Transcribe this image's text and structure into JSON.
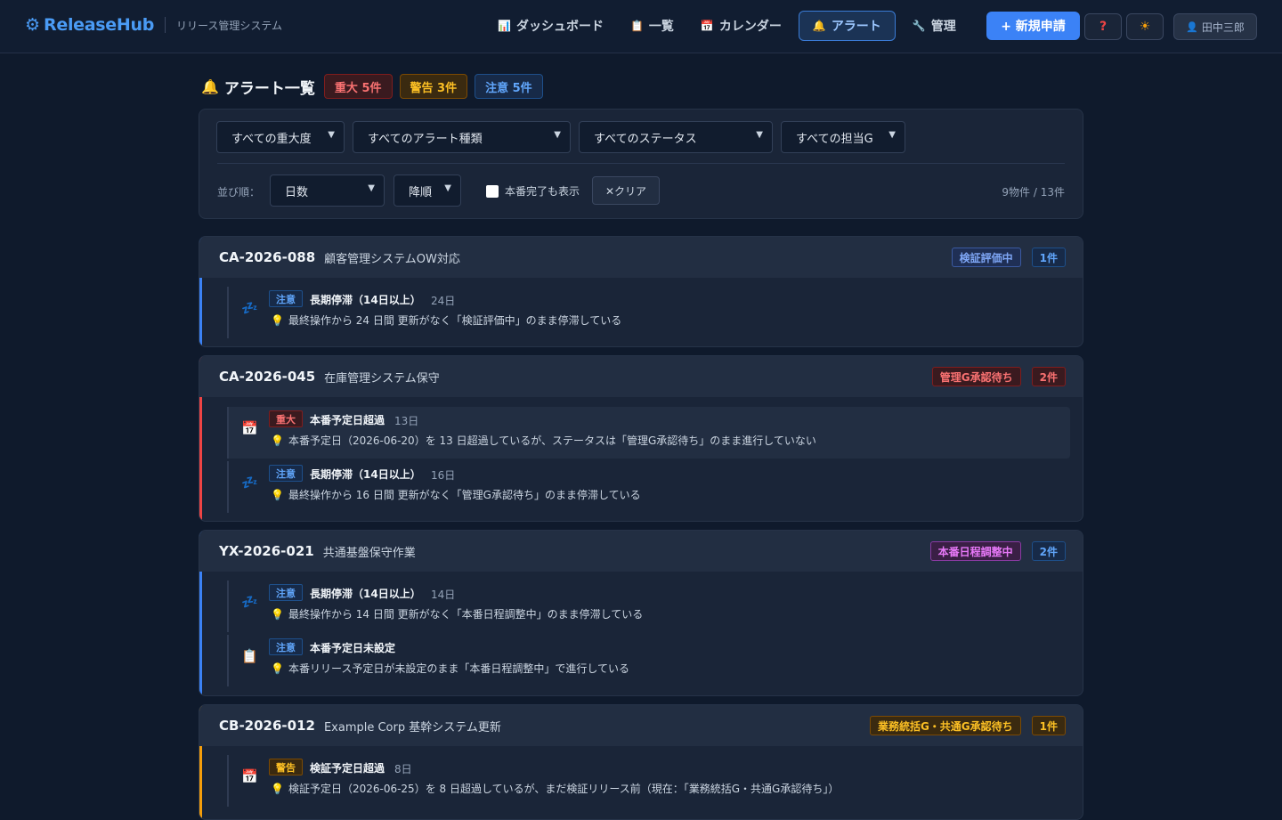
{
  "header": {
    "brand_icon": "gear-icon",
    "brand": "ReleaseHub",
    "subtitle": "リリース管理システム",
    "nav": [
      {
        "icon": "chart-icon",
        "glyph": "📊",
        "label": "ダッシュボード"
      },
      {
        "icon": "list-icon",
        "glyph": "📋",
        "label": "一覧"
      },
      {
        "icon": "calendar-icon",
        "glyph": "📅",
        "label": "カレンダー"
      },
      {
        "icon": "bell-icon",
        "glyph": "🔔",
        "label": "アラート"
      },
      {
        "icon": "wrench-icon",
        "glyph": "🔧",
        "label": "管理"
      }
    ],
    "new_button": "+ 新規申請",
    "help": "?",
    "theme_icon": "sun-icon",
    "user": "田中三郎"
  },
  "page": {
    "title": "アラート一覧",
    "counts": {
      "critical": "重大 5件",
      "warning": "警告 3件",
      "notice": "注意 5件"
    }
  },
  "filters": {
    "severity": "すべての重大度",
    "type": "すべてのアラート種類",
    "status": "すべてのステータス",
    "group": "すべての担当G",
    "sort_label": "並び順：",
    "sort_field": "日数",
    "sort_order": "降順",
    "show_completed": "本番完了も表示",
    "show_completed_checked": false,
    "clear": "✕クリア",
    "result": "9物件 / 13件"
  },
  "cards": [
    {
      "id": "CA-2026-088",
      "name": "顧客管理システムOW対応",
      "status": "検証評価中",
      "count": "1件",
      "alerts": [
        {
          "icon": "zzz-icon",
          "level": "注意",
          "title": "長期停滞（14日以上）",
          "days": "24日",
          "desc": "最終操作から 24 日間 更新がなく「検証評価中」のまま停滞している"
        }
      ]
    },
    {
      "id": "CA-2026-045",
      "name": "在庫管理システム保守",
      "status": "管理G承認待ち",
      "count": "2件",
      "alerts": [
        {
          "icon": "calendar-icon",
          "level": "重大",
          "title": "本番予定日超過",
          "days": "13日",
          "desc": "本番予定日（2026-06-20）を 13 日超過しているが、ステータスは「管理G承認待ち」のまま進行していない"
        },
        {
          "icon": "zzz-icon",
          "level": "注意",
          "title": "長期停滞（14日以上）",
          "days": "16日",
          "desc": "最終操作から 16 日間 更新がなく「管理G承認待ち」のまま停滞している"
        }
      ]
    },
    {
      "id": "YX-2026-021",
      "name": "共通基盤保守作業",
      "status": "本番日程調整中",
      "count": "2件",
      "alerts": [
        {
          "icon": "zzz-icon",
          "level": "注意",
          "title": "長期停滞（14日以上）",
          "days": "14日",
          "desc": "最終操作から 14 日間 更新がなく「本番日程調整中」のまま停滞している"
        },
        {
          "icon": "clipboard-icon",
          "level": "注意",
          "title": "本番予定日未設定",
          "days": "",
          "desc": "本番リリース予定日が未設定のまま「本番日程調整中」で進行している"
        }
      ]
    },
    {
      "id": "CB-2026-012",
      "name": "Example Corp 基幹システム更新",
      "status": "業務統括G・共通G承認待ち",
      "count": "1件",
      "alerts": [
        {
          "icon": "calendar-icon",
          "level": "警告",
          "title": "検証予定日超過",
          "days": "8日",
          "desc": "検証予定日（2026-06-25）を 8 日超過しているが、まだ検証リリース前（現在：「業務統括G・共通G承認待ち」）"
        }
      ]
    }
  ],
  "colors": {
    "accent": "#3b82f6",
    "critical": "#ef4444",
    "warning": "#f59e0b",
    "notice": "#60a5fa"
  }
}
